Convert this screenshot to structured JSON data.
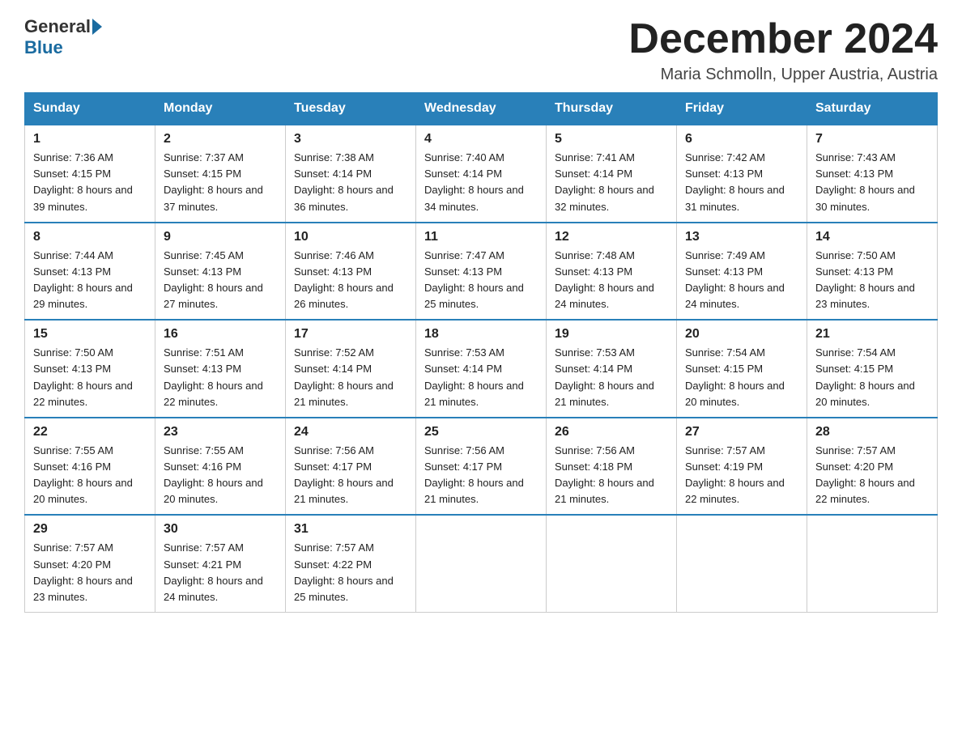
{
  "header": {
    "logo_general": "General",
    "logo_blue": "Blue",
    "month_title": "December 2024",
    "location": "Maria Schmolln, Upper Austria, Austria"
  },
  "weekdays": [
    "Sunday",
    "Monday",
    "Tuesday",
    "Wednesday",
    "Thursday",
    "Friday",
    "Saturday"
  ],
  "weeks": [
    [
      {
        "day": "1",
        "sunrise": "Sunrise: 7:36 AM",
        "sunset": "Sunset: 4:15 PM",
        "daylight": "Daylight: 8 hours and 39 minutes."
      },
      {
        "day": "2",
        "sunrise": "Sunrise: 7:37 AM",
        "sunset": "Sunset: 4:15 PM",
        "daylight": "Daylight: 8 hours and 37 minutes."
      },
      {
        "day": "3",
        "sunrise": "Sunrise: 7:38 AM",
        "sunset": "Sunset: 4:14 PM",
        "daylight": "Daylight: 8 hours and 36 minutes."
      },
      {
        "day": "4",
        "sunrise": "Sunrise: 7:40 AM",
        "sunset": "Sunset: 4:14 PM",
        "daylight": "Daylight: 8 hours and 34 minutes."
      },
      {
        "day": "5",
        "sunrise": "Sunrise: 7:41 AM",
        "sunset": "Sunset: 4:14 PM",
        "daylight": "Daylight: 8 hours and 32 minutes."
      },
      {
        "day": "6",
        "sunrise": "Sunrise: 7:42 AM",
        "sunset": "Sunset: 4:13 PM",
        "daylight": "Daylight: 8 hours and 31 minutes."
      },
      {
        "day": "7",
        "sunrise": "Sunrise: 7:43 AM",
        "sunset": "Sunset: 4:13 PM",
        "daylight": "Daylight: 8 hours and 30 minutes."
      }
    ],
    [
      {
        "day": "8",
        "sunrise": "Sunrise: 7:44 AM",
        "sunset": "Sunset: 4:13 PM",
        "daylight": "Daylight: 8 hours and 29 minutes."
      },
      {
        "day": "9",
        "sunrise": "Sunrise: 7:45 AM",
        "sunset": "Sunset: 4:13 PM",
        "daylight": "Daylight: 8 hours and 27 minutes."
      },
      {
        "day": "10",
        "sunrise": "Sunrise: 7:46 AM",
        "sunset": "Sunset: 4:13 PM",
        "daylight": "Daylight: 8 hours and 26 minutes."
      },
      {
        "day": "11",
        "sunrise": "Sunrise: 7:47 AM",
        "sunset": "Sunset: 4:13 PM",
        "daylight": "Daylight: 8 hours and 25 minutes."
      },
      {
        "day": "12",
        "sunrise": "Sunrise: 7:48 AM",
        "sunset": "Sunset: 4:13 PM",
        "daylight": "Daylight: 8 hours and 24 minutes."
      },
      {
        "day": "13",
        "sunrise": "Sunrise: 7:49 AM",
        "sunset": "Sunset: 4:13 PM",
        "daylight": "Daylight: 8 hours and 24 minutes."
      },
      {
        "day": "14",
        "sunrise": "Sunrise: 7:50 AM",
        "sunset": "Sunset: 4:13 PM",
        "daylight": "Daylight: 8 hours and 23 minutes."
      }
    ],
    [
      {
        "day": "15",
        "sunrise": "Sunrise: 7:50 AM",
        "sunset": "Sunset: 4:13 PM",
        "daylight": "Daylight: 8 hours and 22 minutes."
      },
      {
        "day": "16",
        "sunrise": "Sunrise: 7:51 AM",
        "sunset": "Sunset: 4:13 PM",
        "daylight": "Daylight: 8 hours and 22 minutes."
      },
      {
        "day": "17",
        "sunrise": "Sunrise: 7:52 AM",
        "sunset": "Sunset: 4:14 PM",
        "daylight": "Daylight: 8 hours and 21 minutes."
      },
      {
        "day": "18",
        "sunrise": "Sunrise: 7:53 AM",
        "sunset": "Sunset: 4:14 PM",
        "daylight": "Daylight: 8 hours and 21 minutes."
      },
      {
        "day": "19",
        "sunrise": "Sunrise: 7:53 AM",
        "sunset": "Sunset: 4:14 PM",
        "daylight": "Daylight: 8 hours and 21 minutes."
      },
      {
        "day": "20",
        "sunrise": "Sunrise: 7:54 AM",
        "sunset": "Sunset: 4:15 PM",
        "daylight": "Daylight: 8 hours and 20 minutes."
      },
      {
        "day": "21",
        "sunrise": "Sunrise: 7:54 AM",
        "sunset": "Sunset: 4:15 PM",
        "daylight": "Daylight: 8 hours and 20 minutes."
      }
    ],
    [
      {
        "day": "22",
        "sunrise": "Sunrise: 7:55 AM",
        "sunset": "Sunset: 4:16 PM",
        "daylight": "Daylight: 8 hours and 20 minutes."
      },
      {
        "day": "23",
        "sunrise": "Sunrise: 7:55 AM",
        "sunset": "Sunset: 4:16 PM",
        "daylight": "Daylight: 8 hours and 20 minutes."
      },
      {
        "day": "24",
        "sunrise": "Sunrise: 7:56 AM",
        "sunset": "Sunset: 4:17 PM",
        "daylight": "Daylight: 8 hours and 21 minutes."
      },
      {
        "day": "25",
        "sunrise": "Sunrise: 7:56 AM",
        "sunset": "Sunset: 4:17 PM",
        "daylight": "Daylight: 8 hours and 21 minutes."
      },
      {
        "day": "26",
        "sunrise": "Sunrise: 7:56 AM",
        "sunset": "Sunset: 4:18 PM",
        "daylight": "Daylight: 8 hours and 21 minutes."
      },
      {
        "day": "27",
        "sunrise": "Sunrise: 7:57 AM",
        "sunset": "Sunset: 4:19 PM",
        "daylight": "Daylight: 8 hours and 22 minutes."
      },
      {
        "day": "28",
        "sunrise": "Sunrise: 7:57 AM",
        "sunset": "Sunset: 4:20 PM",
        "daylight": "Daylight: 8 hours and 22 minutes."
      }
    ],
    [
      {
        "day": "29",
        "sunrise": "Sunrise: 7:57 AM",
        "sunset": "Sunset: 4:20 PM",
        "daylight": "Daylight: 8 hours and 23 minutes."
      },
      {
        "day": "30",
        "sunrise": "Sunrise: 7:57 AM",
        "sunset": "Sunset: 4:21 PM",
        "daylight": "Daylight: 8 hours and 24 minutes."
      },
      {
        "day": "31",
        "sunrise": "Sunrise: 7:57 AM",
        "sunset": "Sunset: 4:22 PM",
        "daylight": "Daylight: 8 hours and 25 minutes."
      },
      null,
      null,
      null,
      null
    ]
  ]
}
